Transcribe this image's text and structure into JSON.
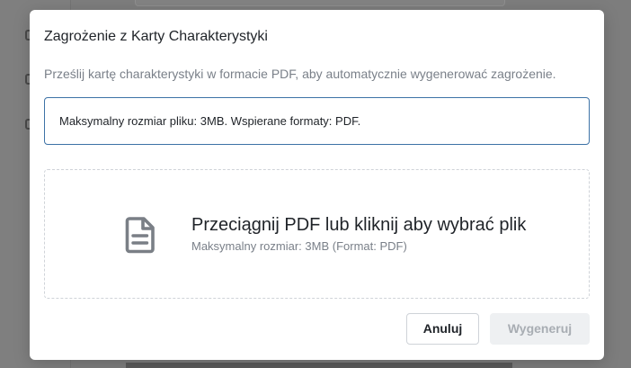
{
  "modal": {
    "title": "Zagrożenie z Karty Charakterystyki",
    "description": "Prześlij kartę charakterystyki w formacie PDF, aby automatycznie wygenerować zagrożenie.",
    "info_text": "Maksymalny rozmiar pliku: 3MB. Wspierane formaty: PDF.",
    "dropzone": {
      "icon": "document-icon",
      "title": "Przeciągnij PDF lub kliknij aby wybrać plik",
      "subtitle": "Maksymalny rozmiar: 3MB (Format: PDF)"
    },
    "buttons": {
      "cancel_label": "Anuluj",
      "generate_label": "Wygeneruj"
    }
  },
  "colors": {
    "overlay": "#7d7d7d",
    "info_border": "#3d72a6",
    "disabled_button_bg": "#eef0f2",
    "disabled_button_text": "#a8adb3"
  }
}
